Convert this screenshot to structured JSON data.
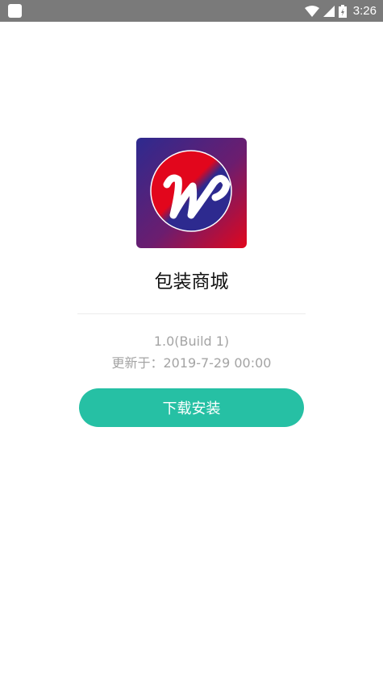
{
  "status_bar": {
    "time": "3:26",
    "icons": [
      "app-notification-icon",
      "wifi-icon",
      "signal-icon",
      "battery-charging-icon"
    ]
  },
  "app": {
    "name": "包装商城",
    "logo_icon": "w-logo-icon",
    "version": "1.0(Build 1)",
    "updated": "更新于：2019-7-29 00:00"
  },
  "actions": {
    "download_label": "下载安装"
  },
  "colors": {
    "status_bar_bg": "#7a7a7a",
    "button_bg": "#26c0a4",
    "logo_blue": "#2d2a8f",
    "logo_red": "#e2061c"
  }
}
